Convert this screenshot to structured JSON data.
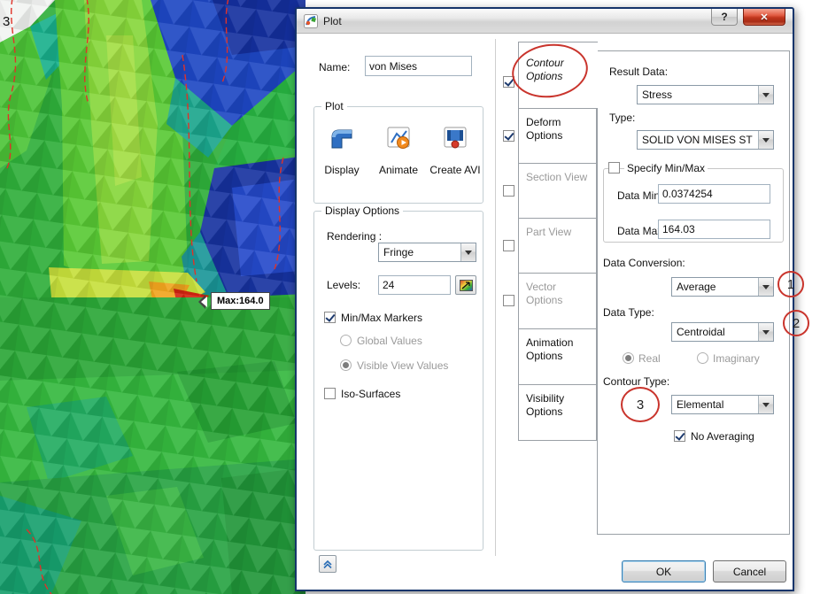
{
  "colors": {
    "annotation_red": "#c9342c",
    "dialog_border": "#16356b",
    "close_button_red": "#c0351d",
    "default_button_border": "#3c7fb1"
  },
  "background": {
    "corner_label": "3",
    "max_marker_label": "Max:164.0"
  },
  "titlebar": {
    "title": "Plot",
    "help_glyph": "?",
    "close_glyph": "✕"
  },
  "left_panel": {
    "name_label": "Name:",
    "name_value": "von Mises",
    "plot_group": {
      "title": "Plot",
      "display_label": "Display",
      "animate_label": "Animate",
      "create_avi_label": "Create AVI"
    },
    "display_options": {
      "title": "Display Options",
      "rendering_label": "Rendering :",
      "rendering_value": "Fringe",
      "levels_label": "Levels:",
      "levels_value": "24",
      "minmax_markers_label": "Min/Max Markers",
      "global_values_label": "Global Values",
      "visible_view_values_label": "Visible View Values",
      "iso_surfaces_label": "Iso-Surfaces"
    }
  },
  "tabs": [
    {
      "label": "Contour Options"
    },
    {
      "label": "Deform Options"
    },
    {
      "label": "Section View"
    },
    {
      "label": "Part View"
    },
    {
      "label": "Vector Options"
    },
    {
      "label": "Animation Options"
    },
    {
      "label": "Visibility Options"
    }
  ],
  "contour_panel": {
    "result_data_label": "Result Data:",
    "result_data_value": "Stress",
    "type_label": "Type:",
    "type_value": "SOLID VON MISES ST",
    "specify_minmax_label": "Specify Min/Max",
    "data_min_label": "Data Min:",
    "data_min_value": "0.0374254",
    "data_max_label": "Data Max:",
    "data_max_value": "164.03",
    "data_conversion_label": "Data Conversion:",
    "data_conversion_value": "Average",
    "data_type_label": "Data Type:",
    "data_type_value": "Centroidal",
    "real_label": "Real",
    "imaginary_label": "Imaginary",
    "contour_type_label": "Contour Type:",
    "contour_type_value": "Elemental",
    "no_averaging_label": "No Averaging"
  },
  "footer": {
    "ok_label": "OK",
    "cancel_label": "Cancel"
  },
  "annotations": {
    "step1": "1",
    "step2": "2",
    "step3": "3"
  }
}
